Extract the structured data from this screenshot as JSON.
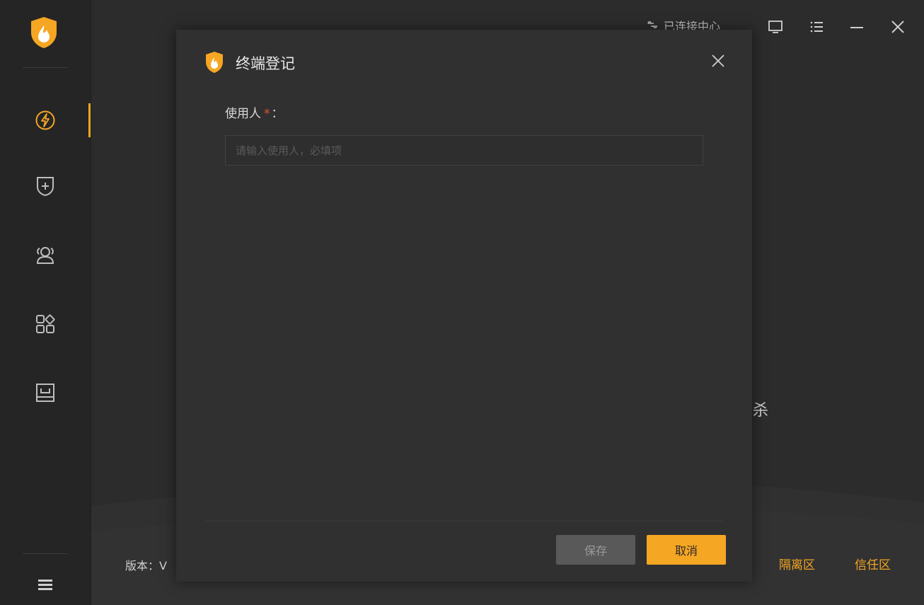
{
  "colors": {
    "accent": "#f5a623",
    "sidebar_bg": "#252525",
    "dialog_bg": "#303030",
    "required": "#e0522b"
  },
  "sidebar": {
    "items": [
      {
        "icon": "lightning-circle-icon",
        "active": true
      },
      {
        "icon": "shield-plus-icon",
        "active": false
      },
      {
        "icon": "users-icon",
        "active": false
      },
      {
        "icon": "apps-grid-icon",
        "active": false
      },
      {
        "icon": "monitor-box-icon",
        "active": false
      }
    ],
    "menu_icon": "hamburger-menu-icon"
  },
  "topbar": {
    "status_text": "已连接中心",
    "controls": [
      "screen-icon",
      "list-icon",
      "minimize-icon",
      "close-icon"
    ]
  },
  "background": {
    "partial_text": "杀"
  },
  "footer": {
    "version_text": "版本：V",
    "links": {
      "quarantine": "隔离区",
      "trust": "信任区"
    }
  },
  "dialog": {
    "title": "终端登记",
    "field": {
      "label": "使用人",
      "required_mark": "*",
      "colon": "：",
      "placeholder": "请输入使用人，必填项",
      "value": ""
    },
    "buttons": {
      "save": "保存",
      "cancel": "取消"
    }
  }
}
